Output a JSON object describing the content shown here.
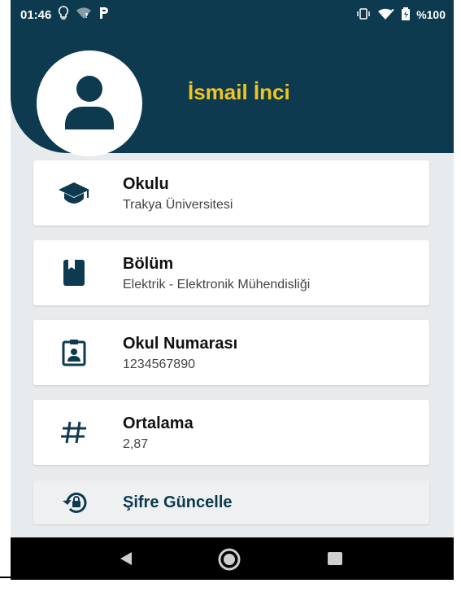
{
  "status_bar": {
    "time": "01:46",
    "left_icons": [
      "lightbulb-icon",
      "wifi-question-icon",
      "parking-icon"
    ],
    "right_icons": [
      "vibrate-icon",
      "wifi-icon",
      "battery-icon"
    ],
    "battery": "%100"
  },
  "profile": {
    "name": "İsmail İnci",
    "avatar_icon": "person-icon"
  },
  "info_cards": [
    {
      "title": "Okulu",
      "value": "Trakya Üniversitesi",
      "icon": "graduation-cap-icon"
    },
    {
      "title": "Bölüm",
      "value": "Elektrik - Elektronik Mühendisliği",
      "icon": "book-icon"
    },
    {
      "title": "Okul Numarası",
      "value": "1234567890",
      "icon": "id-badge-icon"
    },
    {
      "title": "Ortalama",
      "value": "2,87",
      "icon": "hash-icon"
    }
  ],
  "password_button": {
    "label": "Şifre Güncelle",
    "icon": "lock-reset-icon"
  },
  "nav_bar": {
    "items": [
      "back-icon",
      "home-icon",
      "recents-icon"
    ]
  },
  "colors": {
    "header": "#0d3a4f",
    "name": "#f2c41f",
    "background": "#e8ebee"
  }
}
